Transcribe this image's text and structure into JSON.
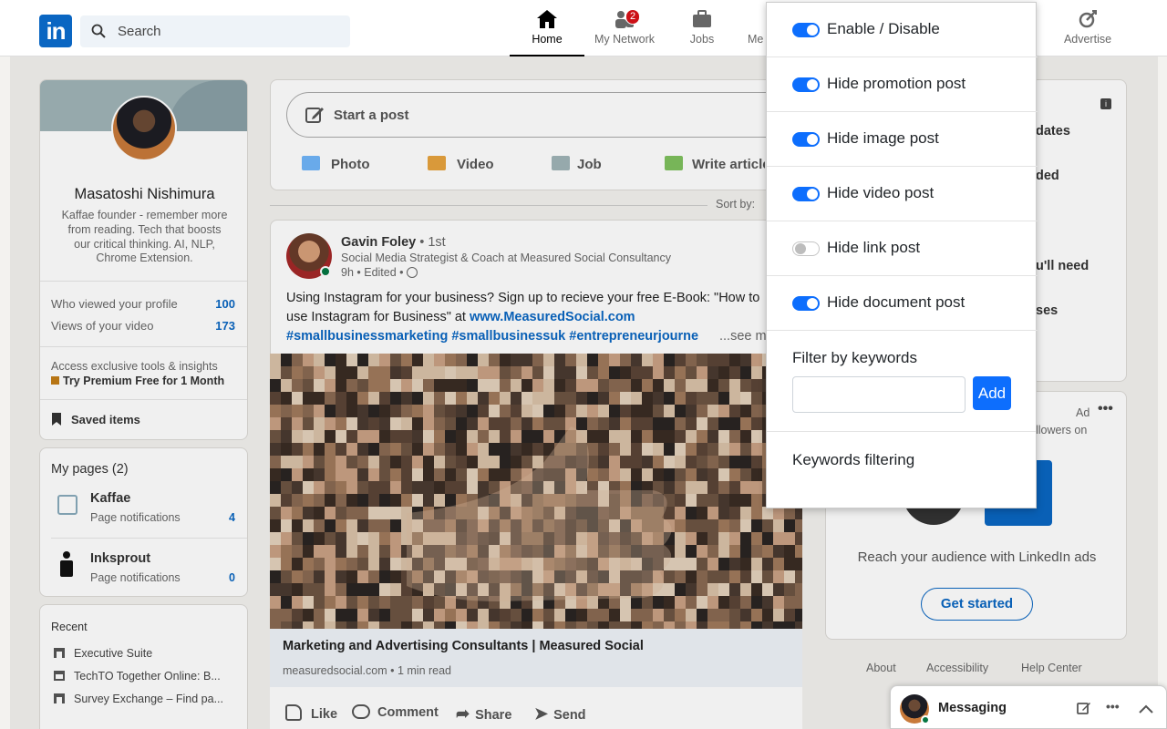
{
  "nav": {
    "search_placeholder": "Search",
    "items": [
      {
        "label": "Home"
      },
      {
        "label": "My Network",
        "badge": "2"
      },
      {
        "label": "Jobs"
      },
      {
        "label": "Me"
      },
      {
        "label": "Advertise"
      }
    ]
  },
  "profile": {
    "name": "Masatoshi Nishimura",
    "bio": [
      "Kaffae founder - remember more",
      "from reading. Tech that boosts",
      "our critical thinking. AI, NLP,",
      "Chrome Extension."
    ],
    "stats": [
      {
        "label": "Who viewed your profile",
        "value": "100"
      },
      {
        "label": "Views of your video",
        "value": "173"
      }
    ],
    "premium_text": "Access exclusive tools & insights",
    "premium_cta": "Try Premium Free for 1 Month",
    "saved_items": "Saved items"
  },
  "pages": {
    "title": "My pages (2)",
    "items": [
      {
        "name": "Kaffae",
        "sub": "Page notifications",
        "count": "4"
      },
      {
        "name": "Inksprout",
        "sub": "Page notifications",
        "count": "0"
      }
    ]
  },
  "recent": {
    "title": "Recent",
    "items": [
      "Executive Suite",
      "TechTO Together Online: B...",
      "Survey Exchange – Find pa..."
    ]
  },
  "composer": {
    "start_post": "Start a post",
    "actions": [
      "Photo",
      "Video",
      "Job",
      "Write article"
    ],
    "sort_label": "Sort by:"
  },
  "post": {
    "author": "Gavin Foley",
    "degree": "• 1st",
    "headline": "Social Media Strategist & Coach at Measured Social Consultancy",
    "meta": "9h • Edited •",
    "text_line1": "Using Instagram for your business? Sign up to recieve your free E-Book: \"How to",
    "text_line2_a": "use Instagram for Business\" at ",
    "text_link": "www.MeasuredSocial.com",
    "hashtags": "#smallbusinessmarketing #smallbusinessuk #entrepreneurjourne",
    "see_more": "...see more",
    "link_title": "Marketing and Advertising Consultants | Measured Social",
    "link_meta": "measuredsocial.com • 1 min read",
    "actions": [
      "Like",
      "Comment",
      "Share",
      "Send"
    ]
  },
  "right": {
    "partials": [
      "dates",
      "ded",
      "u'll need",
      "ses"
    ],
    "ad_label": "Ad",
    "ad_partial": "llowers on",
    "ad_text": "Reach your audience with LinkedIn ads",
    "ad_button": "Get started",
    "footer": [
      "About",
      "Accessibility",
      "Help Center"
    ]
  },
  "popup": {
    "toggles": [
      {
        "label": "Enable / Disable",
        "on": true
      },
      {
        "label": "Hide promotion post",
        "on": true
      },
      {
        "label": "Hide image post",
        "on": true
      },
      {
        "label": "Hide video post",
        "on": true
      },
      {
        "label": "Hide link post",
        "on": false
      },
      {
        "label": "Hide document post",
        "on": true
      }
    ],
    "filter_title": "Filter by keywords",
    "keyword_value": "",
    "add_button": "Add",
    "keywords_title": "Keywords filtering"
  },
  "messaging": {
    "label": "Messaging"
  },
  "colors": {
    "accent": "#0a66c2",
    "toggle_on": "#0d6efd",
    "badge": "#cc1016"
  }
}
